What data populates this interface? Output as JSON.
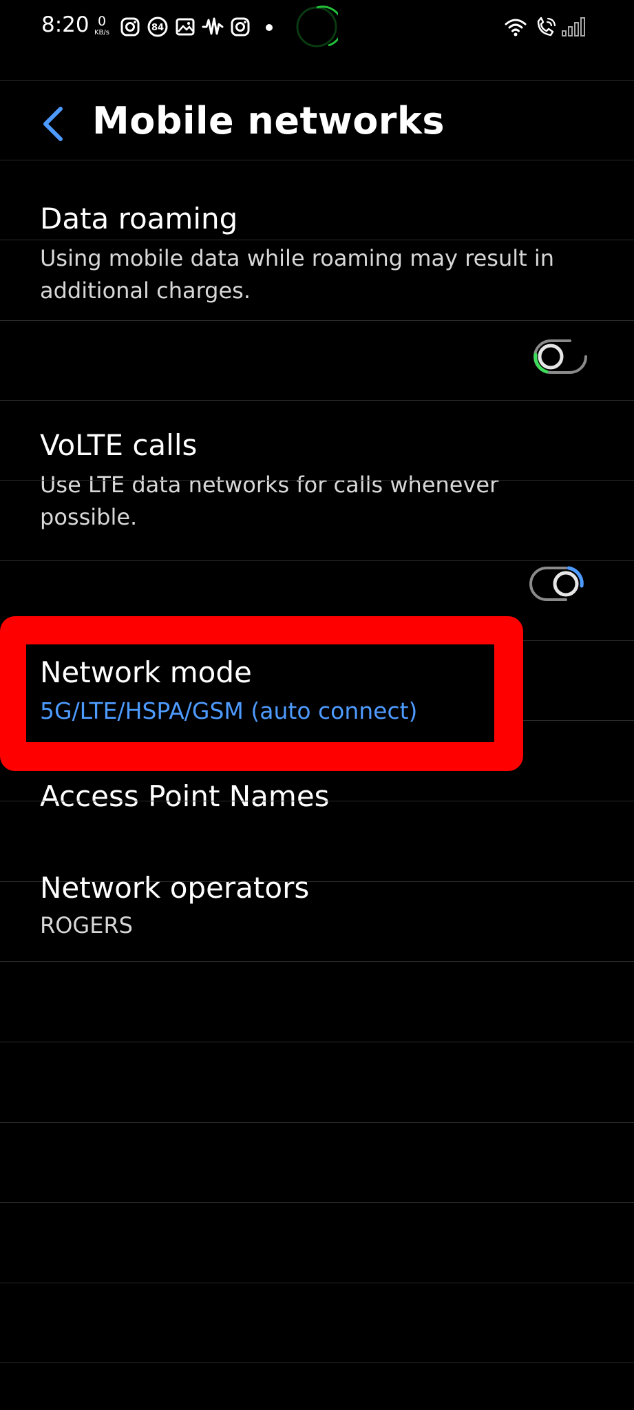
{
  "status_bar": {
    "time": "8:20",
    "net_speed_value": "0",
    "net_speed_unit": "KB/s",
    "badge_count": "84",
    "icons": [
      "instagram-icon",
      "badge-84-icon",
      "gallery-icon",
      "waveform-icon",
      "instagram-icon",
      "dot-icon",
      "wifi-icon",
      "wifi-calling-icon",
      "signal-icon"
    ]
  },
  "header": {
    "back_icon": "chevron-left-icon",
    "title": "Mobile networks"
  },
  "settings": {
    "data_roaming": {
      "title": "Data roaming",
      "description": "Using mobile data while roaming may result in additional charges.",
      "toggle_state": "off"
    },
    "volte_calls": {
      "title": "VoLTE calls",
      "description": "Use LTE data networks for calls whenever possible.",
      "toggle_state": "on"
    },
    "network_mode": {
      "title": "Network mode",
      "value": "5G/LTE/HSPA/GSM (auto connect)"
    },
    "access_point_names": {
      "title": "Access Point Names"
    },
    "network_operators": {
      "title": "Network operators",
      "value": "ROGERS"
    }
  },
  "colors": {
    "background": "#000000",
    "accent_blue": "#4e9bff",
    "toggle_off_accent": "#3ddc5a",
    "highlight_red": "#ff0000",
    "divider": "#2b2b2b"
  }
}
